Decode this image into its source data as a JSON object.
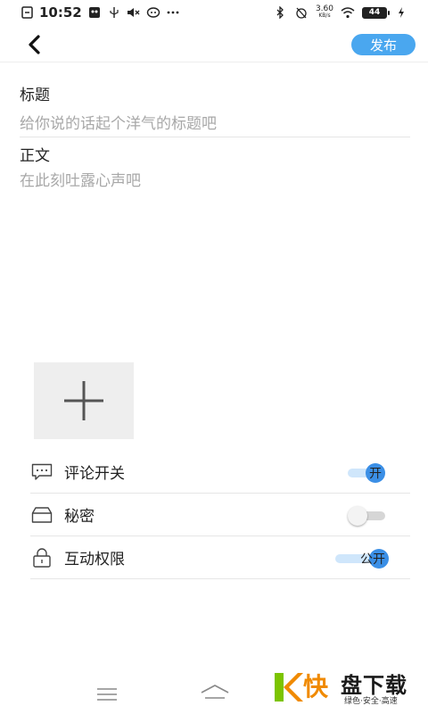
{
  "status_bar": {
    "time": "10:52",
    "net_speed_value": "3.60",
    "net_speed_unit": "KB/s",
    "battery": "44"
  },
  "header": {
    "publish_label": "发布"
  },
  "form": {
    "title_label": "标题",
    "title_placeholder": "给你说的话起个洋气的标题吧",
    "body_label": "正文",
    "body_placeholder": "在此刻吐露心声吧"
  },
  "settings": {
    "comment_label": "评论开关",
    "comment_toggle_text": "开",
    "secret_label": "秘密",
    "interaction_label": "互动权限",
    "interaction_toggle_text": "公开"
  },
  "watermark": {
    "brand": "盘下载",
    "fast": "快",
    "slogan": "绿色·安全·高速"
  },
  "colors": {
    "accent": "#4aa7ef",
    "toggle_on": "#3b8fe6",
    "watermark_orange": "#f08a00",
    "watermark_green": "#7cc400"
  }
}
